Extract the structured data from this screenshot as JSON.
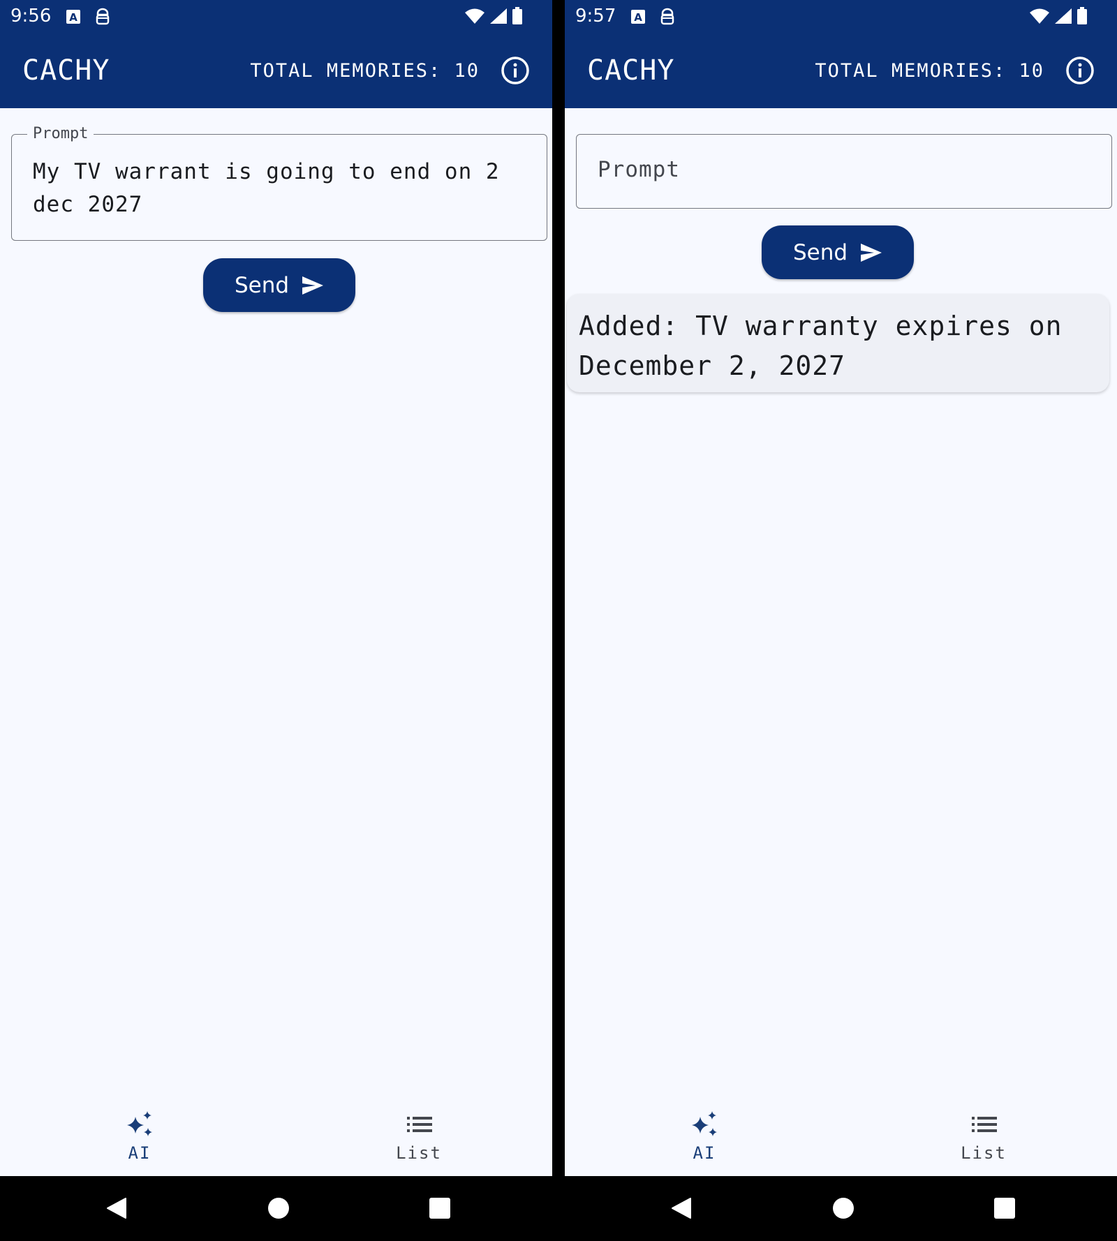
{
  "screens": [
    {
      "status_time": "9:56",
      "app_title": "CACHY",
      "memories_text": "TOTAL MEMORIES: 10",
      "prompt_label": "Prompt",
      "prompt_value": "My TV warrant is going to end on 2 dec 2027",
      "send_label": "Send",
      "nav_ai": "AI",
      "nav_list": "List"
    },
    {
      "status_time": "9:57",
      "app_title": "CACHY",
      "memories_text": "TOTAL MEMORIES: 10",
      "prompt_placeholder": "Prompt",
      "send_label": "Send",
      "response_text": "Added: TV warranty expires on December 2, 2027",
      "nav_ai": "AI",
      "nav_list": "List"
    }
  ],
  "colors": {
    "primary": "#0b3075",
    "background": "#f7f9ff",
    "card": "#eef0f6",
    "nav_active": "#1a3e78"
  }
}
